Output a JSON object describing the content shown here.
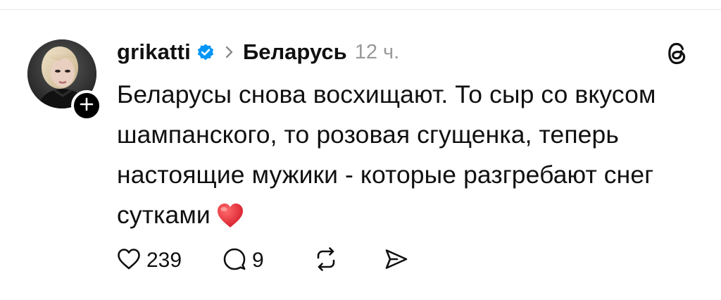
{
  "post": {
    "username": "grikatti",
    "topic": "Беларусь",
    "time": "12 ч.",
    "text": "Беларусы снова восхищают. То сыр со вкусом шампанского, то розовая сгущенка, теперь настоящие мужики - которые разгребают снег сутками",
    "emoji": "red-heart",
    "verified": true
  },
  "actions": {
    "likes": "239",
    "replies": "9"
  },
  "colors": {
    "text": "#101010",
    "muted": "#999999",
    "verified": "#0095f6",
    "heart": "#e0245e"
  },
  "icons": {
    "like": "heart-outline-icon",
    "reply": "comment-icon",
    "repost": "repost-icon",
    "share": "send-icon",
    "logo": "threads-logo-icon",
    "follow": "plus-icon"
  }
}
